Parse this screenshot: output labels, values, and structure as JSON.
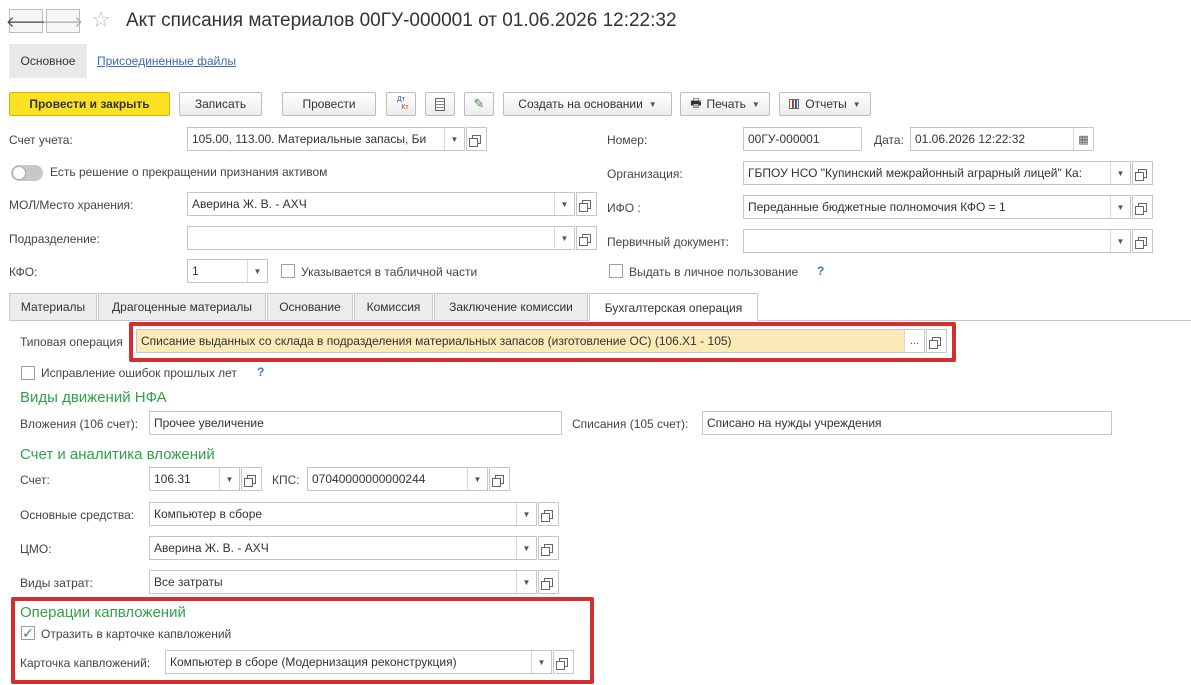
{
  "window": {
    "title": "Акт списания материалов 00ГУ-000001 от 01.06.2026 12:22:32",
    "back_icon": "arrow-left-icon",
    "forward_icon": "arrow-right-icon",
    "star_icon": "star-icon"
  },
  "top_tabs": {
    "main": "Основное",
    "files": "Присоединенные файлы"
  },
  "toolbar": {
    "post_close": "Провести и закрыть",
    "write": "Записать",
    "post": "Провести",
    "dt_kt_top": "Дт",
    "dt_kt_bottom": "Кт",
    "create_based": "Создать на основании",
    "print": "Печать",
    "reports": "Отчеты"
  },
  "header": {
    "account_label": "Счет учета:",
    "account_value": "105.00, 113.00. Материальные запасы, Би",
    "decision_label": "Есть решение о прекращении признания активом",
    "mol_label": "МОЛ/Место хранения:",
    "mol_value": "Аверина Ж. В. - АХЧ",
    "division_label": "Подразделение:",
    "division_value": "",
    "kfo_label": "КФО:",
    "kfo_value": "1",
    "kfo_table_label": "Указывается в табличной части",
    "number_label": "Номер:",
    "number_value": "00ГУ-000001",
    "date_label": "Дата:",
    "date_value": "01.06.2026 12:22:32",
    "org_label": "Организация:",
    "org_value": "ГБПОУ НСО \"Купинский межрайонный аграрный лицей\" Ка:",
    "ifo_label": "ИФО :",
    "ifo_value": "Переданные бюджетные полномочия КФО = 1",
    "primary_doc_label": "Первичный документ:",
    "primary_doc_value": "",
    "personal_use_label": "Выдать в личное пользование",
    "help_mark": "?"
  },
  "tabs": [
    "Материалы",
    "Драгоценные материалы",
    "Основание",
    "Комиссия",
    "Заключение комиссии",
    "Бухгалтерская операция"
  ],
  "operation": {
    "typical_label": "Типовая операция",
    "typical_value": "Списание выданных со склада в подразделения материальных запасов (изготовление ОС) (106.X1 - 105)",
    "ellipsis": "...",
    "fix_errors_label": "Исправление ошибок прошлых лет",
    "nfa_section": "Виды движений НФА",
    "invest_label": "Вложения (106 счет):",
    "invest_value": "Прочее увеличение",
    "writeoff_label": "Списания (105 счет):",
    "writeoff_value": "Списано на нужды учреждения",
    "account_section": "Счет и аналитика вложений",
    "acc_label": "Счет:",
    "acc_value": "106.31",
    "kps_label": "КПС:",
    "kps_value": "07040000000000244",
    "os_label": "Основные средства:",
    "os_value": "Компьютер в сборе",
    "cmo_label": "ЦМО:",
    "cmo_value": "Аверина Ж. В. - АХЧ",
    "costs_label": "Виды затрат:",
    "costs_value": "Все затраты",
    "capex_section": "Операции капвложений",
    "reflect_label": "Отразить в карточке капвложений",
    "card_label": "Карточка капвложений:",
    "card_value": "Компьютер в сборе (Модернизация реконструкция)"
  },
  "colors": {
    "accent_yellow": "#fbe122",
    "section_green": "#2fa24a",
    "highlight_red": "#d32f2f",
    "highlight_field": "#fbe9b7"
  }
}
